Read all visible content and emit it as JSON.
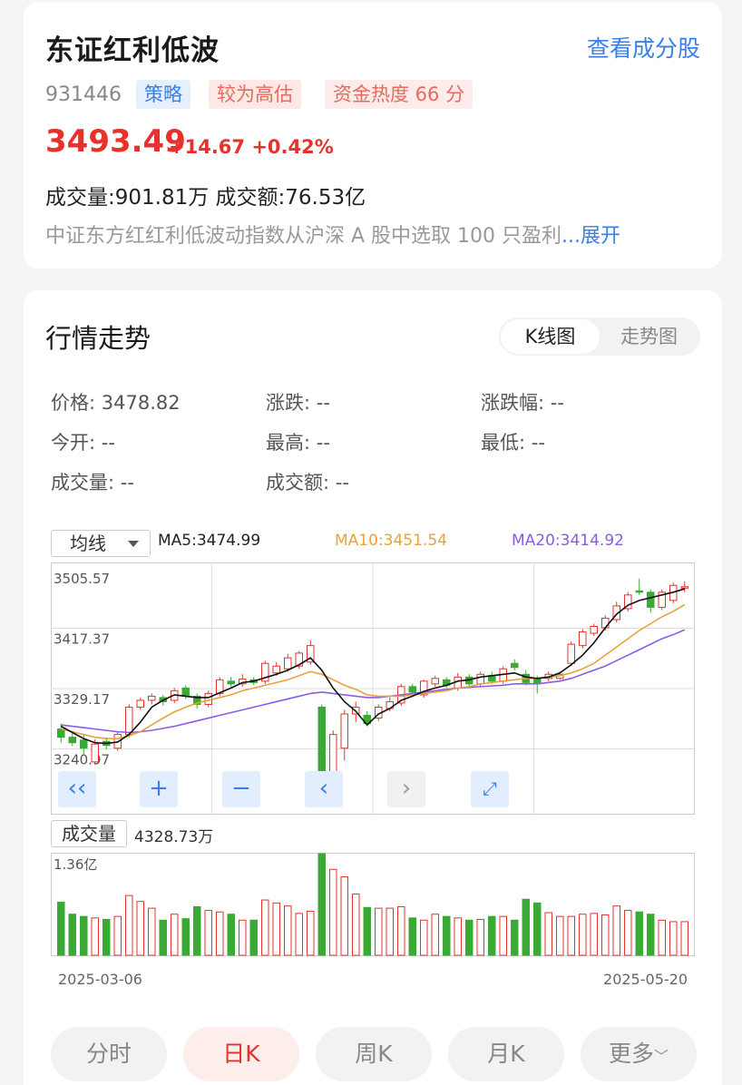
{
  "fund": {
    "name": "东证红利低波",
    "view_link": "查看成分股",
    "code": "931446",
    "tag_strategy": "策略",
    "tag_valuation": "较为高估",
    "tag_heat": "资金热度 66 分",
    "price": "3493.49",
    "change": "+14.67 +0.42%",
    "volume_line": "成交量:901.81万  成交额:76.53亿",
    "description": "中证东方红红利低波动指数从沪深 A 股中选取 100 只盈利",
    "expand": "...展开"
  },
  "market": {
    "title": "行情走势",
    "tabs": [
      "K线图",
      "走势图"
    ],
    "quote": {
      "price": "价格: 3478.82",
      "change": "涨跌: --",
      "change_pct": "涨跌幅: --",
      "open": "今开: --",
      "high": "最高: --",
      "low": "最低: --",
      "volume": "成交量: --",
      "amount": "成交额: --"
    },
    "ma_select": "均线",
    "ma5": "MA5:3474.99",
    "ma10": "MA10:3451.54",
    "ma20": "MA20:3414.92",
    "volume_label": "成交量",
    "volume_value": "4328.73万",
    "date_start": "2025-03-06",
    "date_end": "2025-05-20",
    "periods": [
      "分时",
      "日K",
      "周K",
      "月K",
      "更多"
    ]
  },
  "colors": {
    "up": "#e5322d",
    "down": "#3aa935",
    "ma5": "#111111",
    "ma10": "#e8a23a",
    "ma20": "#8a5ce6",
    "accent": "#3a7ee8"
  },
  "chart_data": {
    "type": "candlestick",
    "y_ticks": [
      "3505.57",
      "3417.37",
      "3329.17",
      "3240.97",
      "3152.77"
    ],
    "ylim": [
      3152.77,
      3505.57
    ],
    "volume_max_label": "1.36亿",
    "volume_ylim": [
      0,
      1.36
    ],
    "candles": [
      {
        "o": 3270,
        "c": 3258,
        "h": 3278,
        "l": 3250,
        "v": 0.71
      },
      {
        "o": 3258,
        "c": 3250,
        "h": 3265,
        "l": 3245,
        "v": 0.55
      },
      {
        "o": 3254,
        "c": 3242,
        "h": 3262,
        "l": 3232,
        "v": 0.52
      },
      {
        "o": 3222,
        "c": 3248,
        "h": 3255,
        "l": 3218,
        "v": 0.5
      },
      {
        "o": 3252,
        "c": 3246,
        "h": 3258,
        "l": 3240,
        "v": 0.48
      },
      {
        "o": 3242,
        "c": 3262,
        "h": 3266,
        "l": 3238,
        "v": 0.52
      },
      {
        "o": 3262,
        "c": 3302,
        "h": 3306,
        "l": 3258,
        "v": 0.8
      },
      {
        "o": 3302,
        "c": 3312,
        "h": 3316,
        "l": 3298,
        "v": 0.72
      },
      {
        "o": 3312,
        "c": 3318,
        "h": 3322,
        "l": 3306,
        "v": 0.63
      },
      {
        "o": 3316,
        "c": 3310,
        "h": 3320,
        "l": 3304,
        "v": 0.47
      },
      {
        "o": 3312,
        "c": 3326,
        "h": 3330,
        "l": 3308,
        "v": 0.55
      },
      {
        "o": 3330,
        "c": 3318,
        "h": 3334,
        "l": 3314,
        "v": 0.49
      },
      {
        "o": 3318,
        "c": 3306,
        "h": 3322,
        "l": 3300,
        "v": 0.65
      },
      {
        "o": 3306,
        "c": 3322,
        "h": 3326,
        "l": 3302,
        "v": 0.6
      },
      {
        "o": 3322,
        "c": 3342,
        "h": 3346,
        "l": 3318,
        "v": 0.58
      },
      {
        "o": 3340,
        "c": 3336,
        "h": 3346,
        "l": 3332,
        "v": 0.55
      },
      {
        "o": 3336,
        "c": 3343,
        "h": 3350,
        "l": 3332,
        "v": 0.47
      },
      {
        "o": 3342,
        "c": 3338,
        "h": 3346,
        "l": 3334,
        "v": 0.47
      },
      {
        "o": 3340,
        "c": 3366,
        "h": 3370,
        "l": 3336,
        "v": 0.74
      },
      {
        "o": 3352,
        "c": 3362,
        "h": 3368,
        "l": 3348,
        "v": 0.7
      },
      {
        "o": 3358,
        "c": 3374,
        "h": 3380,
        "l": 3354,
        "v": 0.66
      },
      {
        "o": 3362,
        "c": 3381,
        "h": 3384,
        "l": 3358,
        "v": 0.56
      },
      {
        "o": 3368,
        "c": 3392,
        "h": 3400,
        "l": 3364,
        "v": 0.59
      },
      {
        "o": 3302,
        "c": 3202,
        "h": 3306,
        "l": 3162,
        "v": 1.36
      },
      {
        "o": 3202,
        "c": 3262,
        "h": 3268,
        "l": 3198,
        "v": 1.15
      },
      {
        "o": 3242,
        "c": 3292,
        "h": 3298,
        "l": 3224,
        "v": 1.05
      },
      {
        "o": 3292,
        "c": 3302,
        "h": 3310,
        "l": 3280,
        "v": 0.82
      },
      {
        "o": 3290,
        "c": 3278,
        "h": 3296,
        "l": 3274,
        "v": 0.64
      },
      {
        "o": 3286,
        "c": 3302,
        "h": 3306,
        "l": 3282,
        "v": 0.63
      },
      {
        "o": 3300,
        "c": 3310,
        "h": 3316,
        "l": 3296,
        "v": 0.63
      },
      {
        "o": 3308,
        "c": 3332,
        "h": 3336,
        "l": 3304,
        "v": 0.65
      },
      {
        "o": 3332,
        "c": 3324,
        "h": 3336,
        "l": 3318,
        "v": 0.5
      },
      {
        "o": 3320,
        "c": 3340,
        "h": 3342,
        "l": 3316,
        "v": 0.47
      },
      {
        "o": 3336,
        "c": 3344,
        "h": 3348,
        "l": 3332,
        "v": 0.55
      },
      {
        "o": 3342,
        "c": 3334,
        "h": 3346,
        "l": 3330,
        "v": 0.52
      },
      {
        "o": 3330,
        "c": 3346,
        "h": 3352,
        "l": 3326,
        "v": 0.5
      },
      {
        "o": 3346,
        "c": 3336,
        "h": 3350,
        "l": 3330,
        "v": 0.47
      },
      {
        "o": 3336,
        "c": 3350,
        "h": 3354,
        "l": 3332,
        "v": 0.48
      },
      {
        "o": 3348,
        "c": 3340,
        "h": 3354,
        "l": 3336,
        "v": 0.52
      },
      {
        "o": 3340,
        "c": 3358,
        "h": 3362,
        "l": 3336,
        "v": 0.52
      },
      {
        "o": 3366,
        "c": 3360,
        "h": 3372,
        "l": 3356,
        "v": 0.47
      },
      {
        "o": 3350,
        "c": 3338,
        "h": 3356,
        "l": 3334,
        "v": 0.75
      },
      {
        "o": 3344,
        "c": 3336,
        "h": 3348,
        "l": 3322,
        "v": 0.7
      },
      {
        "o": 3344,
        "c": 3350,
        "h": 3354,
        "l": 3340,
        "v": 0.57
      },
      {
        "o": 3344,
        "c": 3350,
        "h": 3354,
        "l": 3342,
        "v": 0.52
      },
      {
        "o": 3366,
        "c": 3394,
        "h": 3398,
        "l": 3362,
        "v": 0.52
      },
      {
        "o": 3392,
        "c": 3412,
        "h": 3416,
        "l": 3388,
        "v": 0.55
      },
      {
        "o": 3410,
        "c": 3420,
        "h": 3424,
        "l": 3406,
        "v": 0.56
      },
      {
        "o": 3418,
        "c": 3432,
        "h": 3436,
        "l": 3414,
        "v": 0.54
      },
      {
        "o": 3430,
        "c": 3450,
        "h": 3456,
        "l": 3426,
        "v": 0.66
      },
      {
        "o": 3446,
        "c": 3466,
        "h": 3470,
        "l": 3442,
        "v": 0.6
      },
      {
        "o": 3472,
        "c": 3470,
        "h": 3490,
        "l": 3466,
        "v": 0.58
      },
      {
        "o": 3470,
        "c": 3448,
        "h": 3474,
        "l": 3440,
        "v": 0.55
      },
      {
        "o": 3448,
        "c": 3470,
        "h": 3474,
        "l": 3444,
        "v": 0.47
      },
      {
        "o": 3458,
        "c": 3480,
        "h": 3484,
        "l": 3454,
        "v": 0.45
      },
      {
        "o": 3476,
        "c": 3478,
        "h": 3486,
        "l": 3470,
        "v": 0.45
      }
    ],
    "ma5": [
      3274,
      3265,
      3256,
      3250,
      3249,
      3251,
      3262,
      3280,
      3302,
      3312,
      3320,
      3318,
      3316,
      3316,
      3323,
      3330,
      3338,
      3340,
      3345,
      3350,
      3356,
      3364,
      3374,
      3356,
      3330,
      3310,
      3296,
      3276,
      3292,
      3300,
      3312,
      3318,
      3325,
      3330,
      3334,
      3340,
      3342,
      3346,
      3348,
      3350,
      3352,
      3346,
      3344,
      3346,
      3352,
      3364,
      3378,
      3396,
      3418,
      3438,
      3451,
      3458,
      3462,
      3466,
      3470,
      3475
    ],
    "ma10": [
      3270,
      3266,
      3262,
      3258,
      3256,
      3256,
      3260,
      3266,
      3276,
      3286,
      3295,
      3302,
      3308,
      3312,
      3316,
      3320,
      3326,
      3330,
      3334,
      3338,
      3342,
      3348,
      3354,
      3350,
      3342,
      3334,
      3328,
      3320,
      3318,
      3318,
      3318,
      3320,
      3322,
      3324,
      3326,
      3330,
      3332,
      3336,
      3338,
      3340,
      3342,
      3344,
      3344,
      3346,
      3348,
      3352,
      3358,
      3366,
      3378,
      3390,
      3402,
      3414,
      3424,
      3434,
      3442,
      3452
    ],
    "ma20": [
      3276,
      3274,
      3272,
      3270,
      3268,
      3266,
      3265,
      3266,
      3268,
      3271,
      3274,
      3278,
      3282,
      3286,
      3290,
      3294,
      3298,
      3302,
      3306,
      3310,
      3314,
      3318,
      3322,
      3324,
      3322,
      3320,
      3318,
      3316,
      3316,
      3318,
      3320,
      3322,
      3324,
      3326,
      3328,
      3330,
      3331,
      3332,
      3333,
      3334,
      3336,
      3336,
      3336,
      3338,
      3340,
      3344,
      3350,
      3356,
      3362,
      3370,
      3378,
      3386,
      3394,
      3402,
      3408,
      3415
    ]
  }
}
